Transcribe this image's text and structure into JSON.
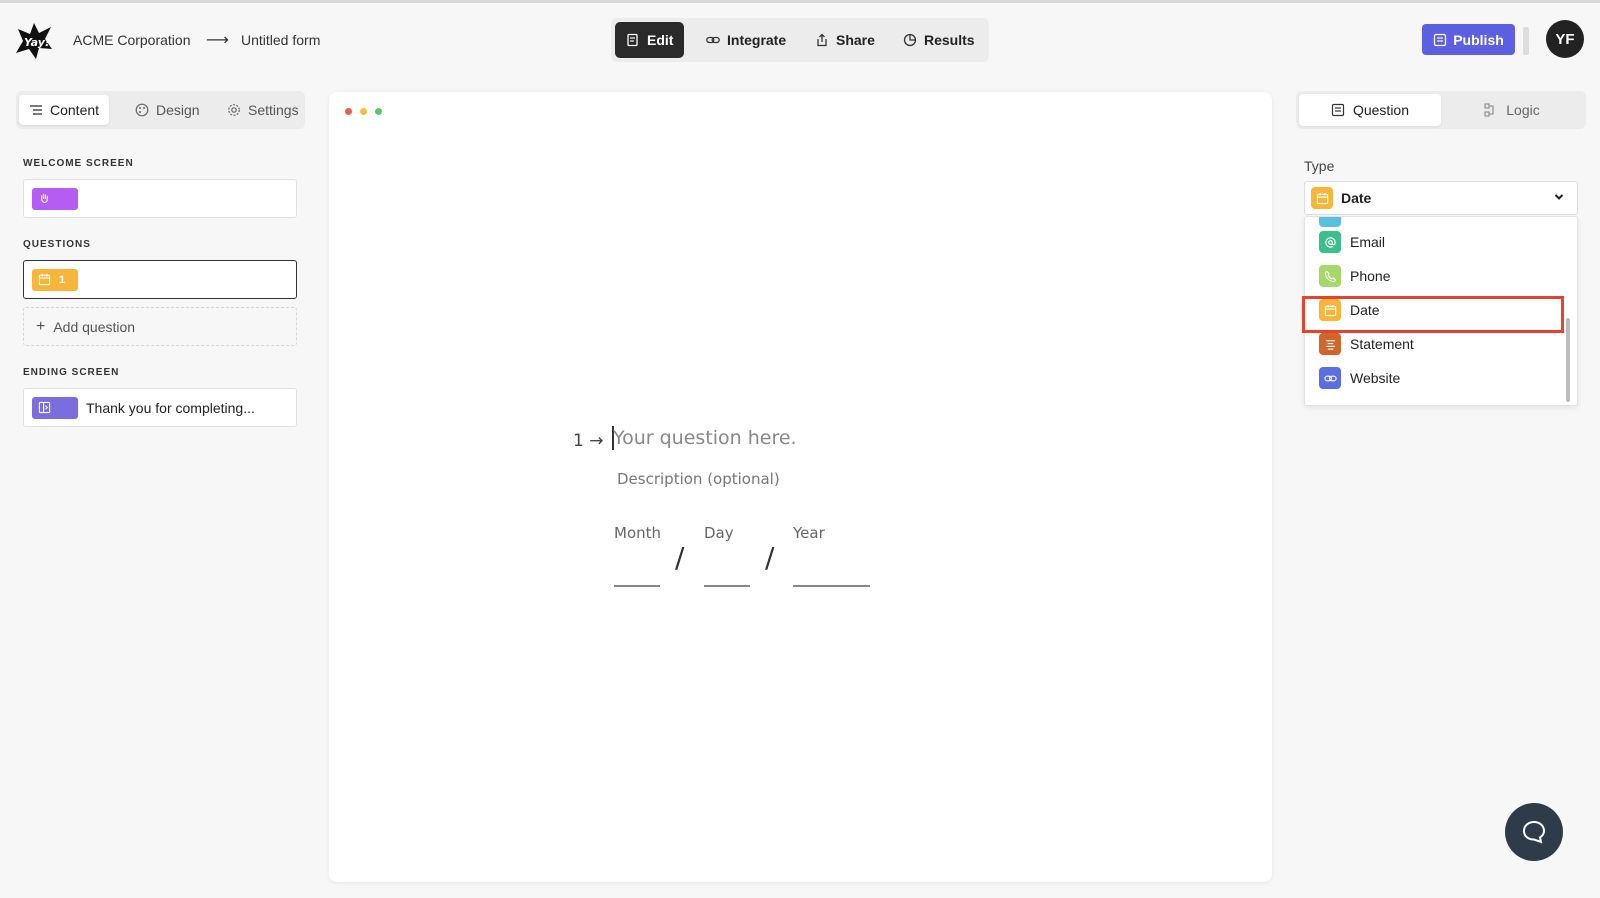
{
  "header": {
    "org": "ACME Corporation",
    "arrow": "⟶",
    "form_name": "Untitled form",
    "modes": {
      "edit": "Edit",
      "integrate": "Integrate",
      "share": "Share",
      "results": "Results"
    },
    "publish": "Publish",
    "avatar": "YF"
  },
  "left_panel": {
    "tabs": {
      "content": "Content",
      "design": "Design",
      "settings": "Settings"
    },
    "welcome_label": "WELCOME SCREEN",
    "questions_label": "QUESTIONS",
    "question_number": "1",
    "add_question": "Add question",
    "ending_label": "ENDING SCREEN",
    "ending_text": "Thank you for completing..."
  },
  "canvas": {
    "question_number": "1 →",
    "question_placeholder": "Your question here.",
    "description": "Description (optional)",
    "date_labels": {
      "month": "Month",
      "day": "Day",
      "year": "Year"
    },
    "separator": "/"
  },
  "right_panel": {
    "tabs": {
      "question": "Question",
      "logic": "Logic"
    },
    "type_label": "Type",
    "type_value": "Date",
    "options": [
      {
        "label": "Email",
        "color": "#3dbf8c",
        "icon": "at-icon"
      },
      {
        "label": "Phone",
        "color": "#a6d96a",
        "icon": "phone-icon"
      },
      {
        "label": "Date",
        "color": "#f7b53b",
        "icon": "calendar-icon"
      },
      {
        "label": "Statement",
        "color": "#d2662a",
        "icon": "statement-icon"
      },
      {
        "label": "Website",
        "color": "#5b6fe0",
        "icon": "link-icon"
      }
    ]
  },
  "colors": {
    "publish": "#5b5fe0",
    "highlight": "#e8412d",
    "welcome_badge": "#b55df2",
    "question_badge": "#f7b53b",
    "ending_badge": "#7a6de0"
  }
}
